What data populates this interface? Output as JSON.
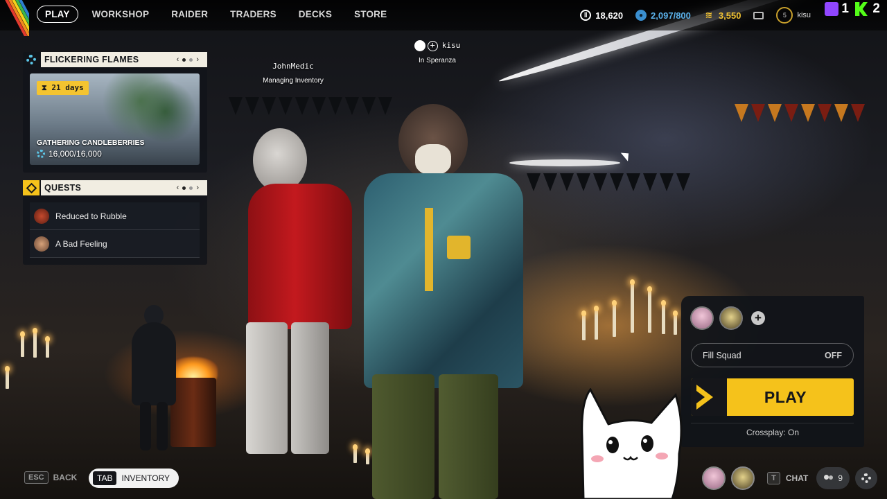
{
  "nav": {
    "items": [
      "PLAY",
      "WORKSHOP",
      "RAIDER",
      "TRADERS",
      "DECKS",
      "STORE"
    ],
    "active": "PLAY"
  },
  "currencies": {
    "credits": "18,620",
    "raider_tokens": "2,097/800",
    "coins": "3,550"
  },
  "profile": {
    "level": "5",
    "username": "kisu"
  },
  "stream_overlay": {
    "twitch_count": "1",
    "kick_count": "2"
  },
  "event_panel": {
    "title": "FLICKERING FLAMES",
    "days_left": "21 days",
    "event_name": "GATHERING CANDLEBERRIES",
    "progress": "16,000/16,000"
  },
  "quests_panel": {
    "title": "QUESTS",
    "items": [
      {
        "label": "Reduced to Rubble"
      },
      {
        "label": "A Bad Feeling"
      }
    ]
  },
  "players": [
    {
      "name": "JohnMedic",
      "status": "Managing Inventory"
    },
    {
      "name": "kisu",
      "status": "In Speranza"
    }
  ],
  "squad": {
    "fill_squad_label": "Fill Squad",
    "fill_squad_value": "OFF",
    "play_label": "PLAY",
    "crossplay": "Crossplay: On"
  },
  "bottom_bar": {
    "back_key": "ESC",
    "back_label": "BACK",
    "inventory_key": "TAB",
    "inventory_label": "INVENTORY",
    "chat_key": "T",
    "chat_label": "CHAT",
    "friends_count": "9"
  },
  "colors": {
    "accent_yellow": "#f5c21b",
    "panel_header": "#f1ede2",
    "panel_bg": "#11141a"
  }
}
